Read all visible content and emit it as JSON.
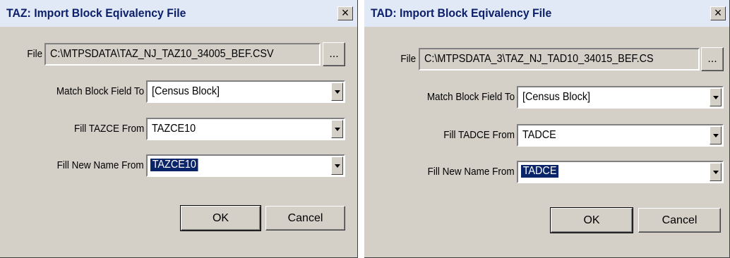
{
  "taz_dialog": {
    "title": "TAZ: Import Block Eqivalency File",
    "close_label": "×",
    "file_label": "File",
    "file_value": "C:\\MTPSDATA\\TAZ_NJ_TAZ10_34005_BEF.CSV",
    "browse_label": "...",
    "match_label": "Match Block Field To",
    "match_value": "[Census Block]",
    "fill_code_label": "Fill TAZCE From",
    "fill_code_value": "TAZCE10",
    "fill_name_label": "Fill New Name From",
    "fill_name_value": "TAZCE10",
    "ok_label": "OK",
    "cancel_label": "Cancel"
  },
  "tad_dialog": {
    "title": "TAD: Import Block Eqivalency File",
    "close_label": "×",
    "file_label": "File",
    "file_value": "C:\\MTPSDATA_3\\TAZ_NJ_TAD10_34015_BEF.CS",
    "browse_label": "...",
    "match_label": "Match Block Field To",
    "match_value": "[Census Block]",
    "fill_code_label": "Fill TADCE From",
    "fill_code_value": "TADCE",
    "fill_name_label": "Fill New Name From",
    "fill_name_value": "TADCE",
    "ok_label": "OK",
    "cancel_label": "Cancel"
  }
}
